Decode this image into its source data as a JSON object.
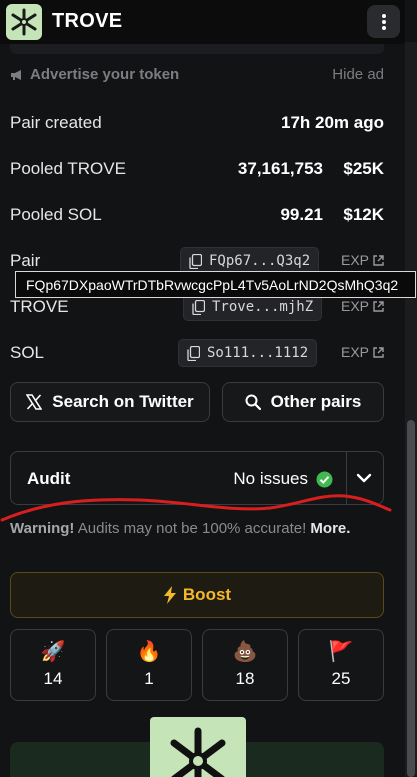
{
  "header": {
    "title": "TROVE"
  },
  "ad": {
    "label": "Advertise your token",
    "hide": "Hide ad"
  },
  "stats": {
    "pair_created": {
      "label": "Pair created",
      "value": "17h 20m ago"
    },
    "pooled_trove": {
      "label": "Pooled TROVE",
      "amount": "37,161,753",
      "usd": "$25K"
    },
    "pooled_sol": {
      "label": "Pooled SOL",
      "amount": "99.21",
      "usd": "$12K"
    }
  },
  "addresses": {
    "pair": {
      "label": "Pair",
      "short": "FQp67...Q3q2",
      "exp": "EXP"
    },
    "trove": {
      "label": "TROVE",
      "short": "Trove...mjhZ",
      "exp": "EXP"
    },
    "sol": {
      "label": "SOL",
      "short": "So111...1112",
      "exp": "EXP"
    }
  },
  "tooltip": {
    "full_address": "FQp67DXpaoWTrDTbRvwcgcPpL4Tv5AoLrND2QsMhQ3q2"
  },
  "buttons": {
    "twitter": "Search on Twitter",
    "other_pairs": "Other pairs"
  },
  "audit": {
    "title": "Audit",
    "status": "No issues"
  },
  "warning": {
    "bold": "Warning!",
    "text": " Audits may not be 100% accurate! ",
    "more": "More."
  },
  "boost": {
    "label": "Boost"
  },
  "reactions": [
    {
      "icon": "rocket-icon",
      "emoji": "🚀",
      "count": "14"
    },
    {
      "icon": "fire-icon",
      "emoji": "🔥",
      "count": "1"
    },
    {
      "icon": "poop-icon",
      "emoji": "💩",
      "count": "18"
    },
    {
      "icon": "flag-icon",
      "emoji": "🚩",
      "count": "25"
    }
  ],
  "colors": {
    "accent": "#f5b82a",
    "success": "#3fb950",
    "annotation": "#d81e1e",
    "logo_bg": "#c5e4b8"
  }
}
